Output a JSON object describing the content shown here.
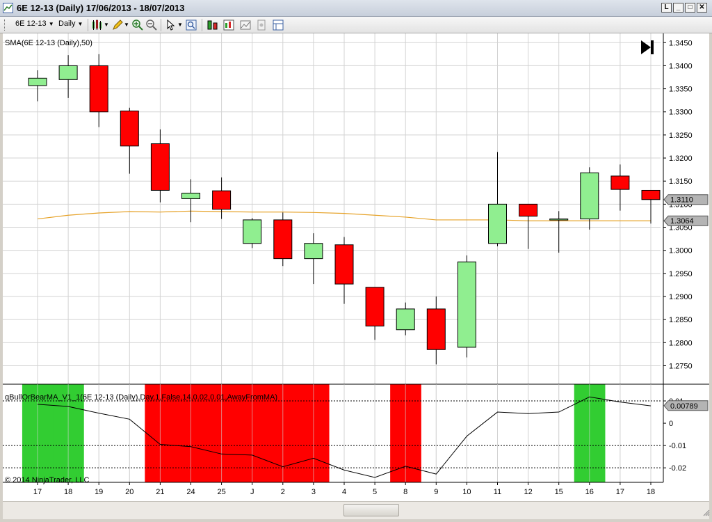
{
  "window": {
    "title": "6E 12-13 (Daily)  17/06/2013 - 18/07/2013",
    "buttons": {
      "minimize": "_",
      "restore": "□",
      "close": "✕",
      "extra": "L"
    }
  },
  "toolbar": {
    "instrument": "6E 12-13",
    "interval": "Daily"
  },
  "colors": {
    "up_candle": "#90ee90",
    "down_candle": "#ff0000",
    "sma_line": "#e6a228",
    "bull_zone": "#32cd32",
    "bear_zone": "#ff0000",
    "grid": "#d3d3d3",
    "price_marker": "#b4b4b4"
  },
  "chart_data": [
    {
      "type": "candlestick",
      "label": "SMA(6E 12-13 (Daily),50)",
      "categories": [
        "17",
        "18",
        "19",
        "20",
        "21",
        "24",
        "25",
        "J",
        "2",
        "3",
        "4",
        "5",
        "8",
        "9",
        "10",
        "11",
        "12",
        "15",
        "16",
        "17",
        "18"
      ],
      "candles": [
        {
          "open": 1.3357,
          "high": 1.339,
          "low": 1.3323,
          "close": 1.3373
        },
        {
          "open": 1.337,
          "high": 1.3423,
          "low": 1.333,
          "close": 1.34
        },
        {
          "open": 1.34,
          "high": 1.3425,
          "low": 1.3267,
          "close": 1.33
        },
        {
          "open": 1.3302,
          "high": 1.3309,
          "low": 1.3166,
          "close": 1.3226
        },
        {
          "open": 1.3231,
          "high": 1.3262,
          "low": 1.3104,
          "close": 1.313
        },
        {
          "open": 1.3112,
          "high": 1.3154,
          "low": 1.3061,
          "close": 1.3124
        },
        {
          "open": 1.3129,
          "high": 1.3158,
          "low": 1.3068,
          "close": 1.3089
        },
        {
          "open": 1.3015,
          "high": 1.307,
          "low": 1.3005,
          "close": 1.3066
        },
        {
          "open": 1.3066,
          "high": 1.3082,
          "low": 1.2966,
          "close": 1.2982
        },
        {
          "open": 1.2982,
          "high": 1.3037,
          "low": 1.2927,
          "close": 1.3015
        },
        {
          "open": 1.3012,
          "high": 1.3029,
          "low": 1.2884,
          "close": 1.2927
        },
        {
          "open": 1.292,
          "high": 1.292,
          "low": 1.2806,
          "close": 1.2836
        },
        {
          "open": 1.2828,
          "high": 1.2887,
          "low": 1.2816,
          "close": 1.2873
        },
        {
          "open": 1.2873,
          "high": 1.29,
          "low": 1.2753,
          "close": 1.2785
        },
        {
          "open": 1.279,
          "high": 1.2989,
          "low": 1.2768,
          "close": 1.2975
        },
        {
          "open": 1.3015,
          "high": 1.3213,
          "low": 1.3009,
          "close": 1.31
        },
        {
          "open": 1.31,
          "high": 1.31,
          "low": 1.3003,
          "close": 1.3074
        },
        {
          "open": 1.3068,
          "high": 1.3085,
          "low": 1.2995,
          "close": 1.3068
        },
        {
          "open": 1.3068,
          "high": 1.318,
          "low": 1.3045,
          "close": 1.3168
        },
        {
          "open": 1.3161,
          "high": 1.3186,
          "low": 1.3086,
          "close": 1.3132
        },
        {
          "open": 1.313,
          "high": 1.313,
          "low": 1.3058,
          "close": 1.311
        }
      ],
      "sma": [
        1.3068,
        1.3076,
        1.3081,
        1.3084,
        1.3083,
        1.3085,
        1.3084,
        1.3083,
        1.3083,
        1.3082,
        1.308,
        1.3076,
        1.3072,
        1.3066,
        1.3066,
        1.3066,
        1.3064,
        1.3064,
        1.3064,
        1.3064,
        1.3064
      ],
      "y_ticks": [
        "1.3450",
        "1.3400",
        "1.3350",
        "1.3300",
        "1.3250",
        "1.3200",
        "1.3150",
        "1.3100",
        "1.3050",
        "1.3000",
        "1.2950",
        "1.2900",
        "1.2850",
        "1.2800",
        "1.2750"
      ],
      "ylim": [
        1.271,
        1.347
      ],
      "last_price_label": "1.3110",
      "sma_label": "1.3064",
      "grid": true
    },
    {
      "type": "line",
      "label": "qBullOrBearMA_V1_1(6E 12-13 (Daily),Day,1,False,14,0.02,0.01,AwayFromMA)",
      "values": [
        0.0085,
        0.0075,
        0.0045,
        0.0018,
        -0.0095,
        -0.0105,
        -0.0138,
        -0.0143,
        -0.0195,
        -0.0157,
        -0.021,
        -0.0243,
        -0.0193,
        -0.0228,
        -0.0058,
        0.005,
        0.0043,
        0.005,
        0.0118,
        0.0095,
        0.0078
      ],
      "zones": [
        "bull",
        "bull",
        "none",
        "none",
        "bear",
        "bear",
        "bear",
        "bear",
        "bear",
        "bear",
        "none",
        "none",
        "bear",
        "none",
        "none",
        "none",
        "none",
        "none",
        "bull",
        "none",
        "none"
      ],
      "y_ticks": [
        "0.01",
        "0",
        "-0.01",
        "-0.02"
      ],
      "dashed_levels": [
        0.01,
        -0.01,
        -0.02
      ],
      "ylim": [
        -0.0265,
        0.0175
      ],
      "last_value_label": "0.00789"
    }
  ],
  "copyright": "© 2014 NinjaTrader, LLC"
}
